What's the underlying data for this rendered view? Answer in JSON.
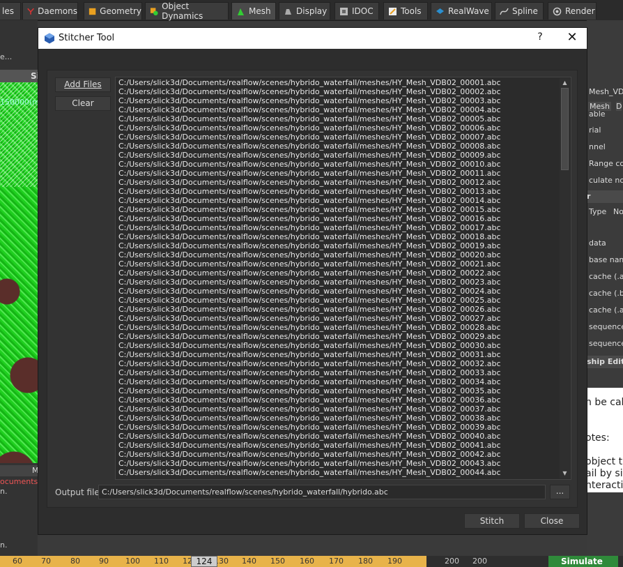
{
  "tabs": [
    {
      "label": "les",
      "icon": "particles-icon"
    },
    {
      "label": "Daemons",
      "icon": "daemon-icon"
    },
    {
      "label": "Geometry",
      "icon": "geometry-cube-icon"
    },
    {
      "label": "Object Dynamics",
      "icon": "object-dynamics-icon"
    },
    {
      "label": "Mesh",
      "icon": "mesh-icon"
    },
    {
      "label": "Display",
      "icon": "display-icon"
    },
    {
      "label": "IDOC",
      "icon": "idoc-icon"
    },
    {
      "label": "Tools",
      "icon": "tools-icon"
    },
    {
      "label": "RealWave",
      "icon": "realwave-icon"
    },
    {
      "label": "Spline",
      "icon": "spline-icon"
    },
    {
      "label": "Render",
      "icon": "render-icon"
    }
  ],
  "active_tab": "Mesh",
  "background": {
    "left_top_text": "e...",
    "viewport_header": "Si",
    "viewport_coord": "150000(m",
    "left_bottom_header": "M",
    "left_path_text": "ocuments\\re",
    "left_small_1": "n.",
    "left_small_2": "n.",
    "right_items": [
      "Mesh_VDB",
      "Mesh",
      "D",
      "able",
      "rial",
      "nnel",
      "Range colo",
      "culate norm",
      "r",
      "Type",
      "No",
      "data",
      "base name",
      "cache (.ab",
      "cache (.bi",
      "cache (.as",
      "sequence",
      "sequence",
      "ship Edito"
    ],
    "right_white_texts": [
      "n be calc",
      "otes:",
      "object th",
      "ail by sim",
      "nteractio"
    ],
    "timeline_ticks": [
      "60",
      "70",
      "80",
      "90",
      "100",
      "110",
      "120",
      "130",
      "140",
      "150",
      "160",
      "170",
      "180",
      "190",
      "200",
      "200"
    ],
    "timeline_current": "124",
    "simulate_label": "Simulate"
  },
  "dialog": {
    "title": "Stitcher Tool",
    "help_label": "?",
    "close_label": "✕",
    "add_files_label": "Add Files",
    "clear_label": "Clear",
    "files": [
      "C:/Users/slick3d/Documents/realflow/scenes/hybrido_waterfall/meshes/HY_Mesh_VDB02_00001.abc",
      "C:/Users/slick3d/Documents/realflow/scenes/hybrido_waterfall/meshes/HY_Mesh_VDB02_00002.abc",
      "C:/Users/slick3d/Documents/realflow/scenes/hybrido_waterfall/meshes/HY_Mesh_VDB02_00003.abc",
      "C:/Users/slick3d/Documents/realflow/scenes/hybrido_waterfall/meshes/HY_Mesh_VDB02_00004.abc",
      "C:/Users/slick3d/Documents/realflow/scenes/hybrido_waterfall/meshes/HY_Mesh_VDB02_00005.abc",
      "C:/Users/slick3d/Documents/realflow/scenes/hybrido_waterfall/meshes/HY_Mesh_VDB02_00006.abc",
      "C:/Users/slick3d/Documents/realflow/scenes/hybrido_waterfall/meshes/HY_Mesh_VDB02_00007.abc",
      "C:/Users/slick3d/Documents/realflow/scenes/hybrido_waterfall/meshes/HY_Mesh_VDB02_00008.abc",
      "C:/Users/slick3d/Documents/realflow/scenes/hybrido_waterfall/meshes/HY_Mesh_VDB02_00009.abc",
      "C:/Users/slick3d/Documents/realflow/scenes/hybrido_waterfall/meshes/HY_Mesh_VDB02_00010.abc",
      "C:/Users/slick3d/Documents/realflow/scenes/hybrido_waterfall/meshes/HY_Mesh_VDB02_00011.abc",
      "C:/Users/slick3d/Documents/realflow/scenes/hybrido_waterfall/meshes/HY_Mesh_VDB02_00012.abc",
      "C:/Users/slick3d/Documents/realflow/scenes/hybrido_waterfall/meshes/HY_Mesh_VDB02_00013.abc",
      "C:/Users/slick3d/Documents/realflow/scenes/hybrido_waterfall/meshes/HY_Mesh_VDB02_00014.abc",
      "C:/Users/slick3d/Documents/realflow/scenes/hybrido_waterfall/meshes/HY_Mesh_VDB02_00015.abc",
      "C:/Users/slick3d/Documents/realflow/scenes/hybrido_waterfall/meshes/HY_Mesh_VDB02_00016.abc",
      "C:/Users/slick3d/Documents/realflow/scenes/hybrido_waterfall/meshes/HY_Mesh_VDB02_00017.abc",
      "C:/Users/slick3d/Documents/realflow/scenes/hybrido_waterfall/meshes/HY_Mesh_VDB02_00018.abc",
      "C:/Users/slick3d/Documents/realflow/scenes/hybrido_waterfall/meshes/HY_Mesh_VDB02_00019.abc",
      "C:/Users/slick3d/Documents/realflow/scenes/hybrido_waterfall/meshes/HY_Mesh_VDB02_00020.abc",
      "C:/Users/slick3d/Documents/realflow/scenes/hybrido_waterfall/meshes/HY_Mesh_VDB02_00021.abc",
      "C:/Users/slick3d/Documents/realflow/scenes/hybrido_waterfall/meshes/HY_Mesh_VDB02_00022.abc",
      "C:/Users/slick3d/Documents/realflow/scenes/hybrido_waterfall/meshes/HY_Mesh_VDB02_00023.abc",
      "C:/Users/slick3d/Documents/realflow/scenes/hybrido_waterfall/meshes/HY_Mesh_VDB02_00024.abc",
      "C:/Users/slick3d/Documents/realflow/scenes/hybrido_waterfall/meshes/HY_Mesh_VDB02_00025.abc",
      "C:/Users/slick3d/Documents/realflow/scenes/hybrido_waterfall/meshes/HY_Mesh_VDB02_00026.abc",
      "C:/Users/slick3d/Documents/realflow/scenes/hybrido_waterfall/meshes/HY_Mesh_VDB02_00027.abc",
      "C:/Users/slick3d/Documents/realflow/scenes/hybrido_waterfall/meshes/HY_Mesh_VDB02_00028.abc",
      "C:/Users/slick3d/Documents/realflow/scenes/hybrido_waterfall/meshes/HY_Mesh_VDB02_00029.abc",
      "C:/Users/slick3d/Documents/realflow/scenes/hybrido_waterfall/meshes/HY_Mesh_VDB02_00030.abc",
      "C:/Users/slick3d/Documents/realflow/scenes/hybrido_waterfall/meshes/HY_Mesh_VDB02_00031.abc",
      "C:/Users/slick3d/Documents/realflow/scenes/hybrido_waterfall/meshes/HY_Mesh_VDB02_00032.abc",
      "C:/Users/slick3d/Documents/realflow/scenes/hybrido_waterfall/meshes/HY_Mesh_VDB02_00033.abc",
      "C:/Users/slick3d/Documents/realflow/scenes/hybrido_waterfall/meshes/HY_Mesh_VDB02_00034.abc",
      "C:/Users/slick3d/Documents/realflow/scenes/hybrido_waterfall/meshes/HY_Mesh_VDB02_00035.abc",
      "C:/Users/slick3d/Documents/realflow/scenes/hybrido_waterfall/meshes/HY_Mesh_VDB02_00036.abc",
      "C:/Users/slick3d/Documents/realflow/scenes/hybrido_waterfall/meshes/HY_Mesh_VDB02_00037.abc",
      "C:/Users/slick3d/Documents/realflow/scenes/hybrido_waterfall/meshes/HY_Mesh_VDB02_00038.abc",
      "C:/Users/slick3d/Documents/realflow/scenes/hybrido_waterfall/meshes/HY_Mesh_VDB02_00039.abc",
      "C:/Users/slick3d/Documents/realflow/scenes/hybrido_waterfall/meshes/HY_Mesh_VDB02_00040.abc",
      "C:/Users/slick3d/Documents/realflow/scenes/hybrido_waterfall/meshes/HY_Mesh_VDB02_00041.abc",
      "C:/Users/slick3d/Documents/realflow/scenes/hybrido_waterfall/meshes/HY_Mesh_VDB02_00042.abc",
      "C:/Users/slick3d/Documents/realflow/scenes/hybrido_waterfall/meshes/HY_Mesh_VDB02_00043.abc",
      "C:/Users/slick3d/Documents/realflow/scenes/hybrido_waterfall/meshes/HY_Mesh_VDB02_00044.abc"
    ],
    "output_label": "Output file:",
    "output_value": "C:/Users/slick3d/Documents/realflow/scenes/hybrido_waterfall/hybrido.abc",
    "browse_label": "...",
    "stitch_label": "Stitch",
    "close_button_label": "Close"
  },
  "colors": {
    "accent_logo": "#2a5db0",
    "timeline": "#e8b34a",
    "simulate": "#2f8a3a"
  }
}
